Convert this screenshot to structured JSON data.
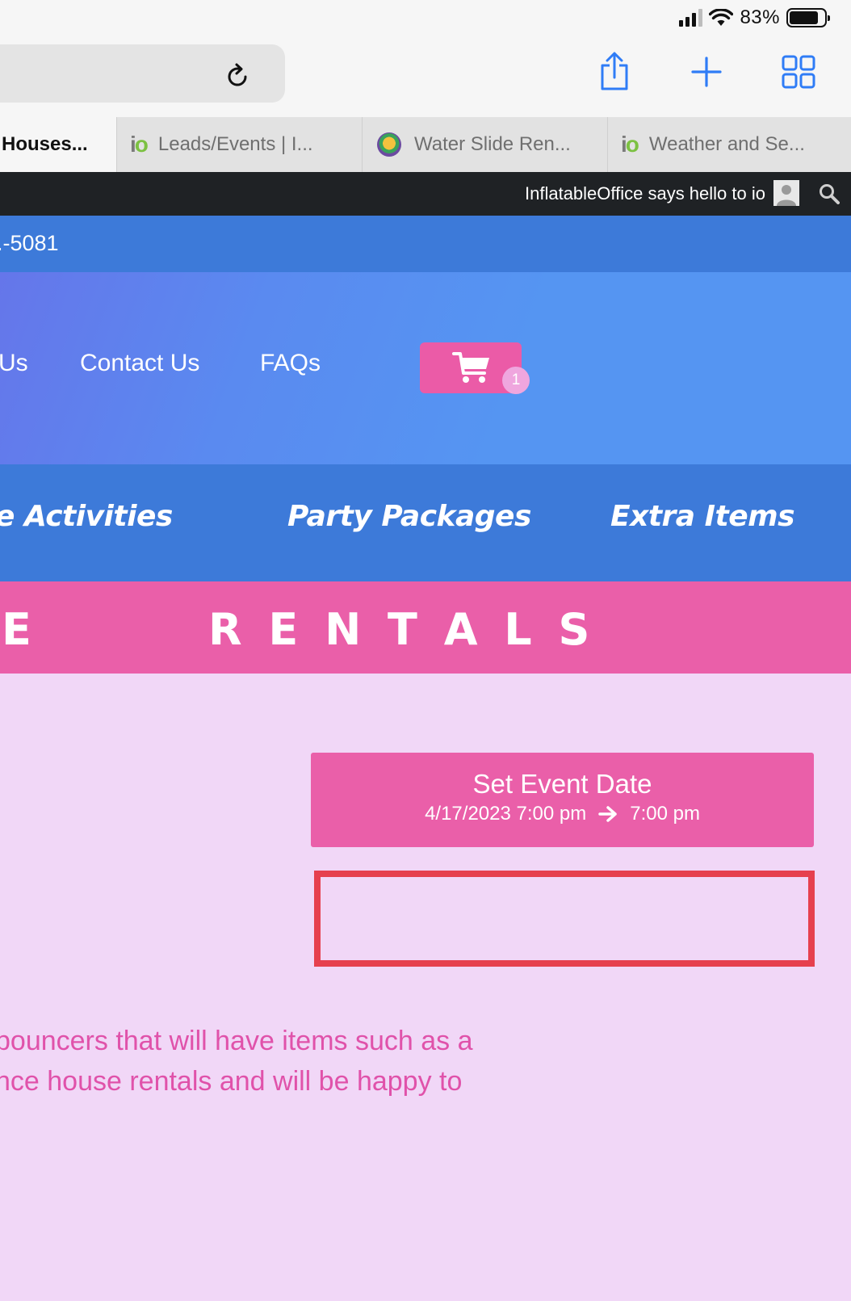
{
  "status_bar": {
    "battery_percent": "83%",
    "battery_level": 0.83
  },
  "tabs": [
    {
      "label": "Houses..."
    },
    {
      "label": "Leads/Events | I...",
      "icon": "io-logo-icon"
    },
    {
      "label": "Water Slide Ren...",
      "icon": "site-favicon-icon"
    },
    {
      "label": "Weather and Se...",
      "icon": "io-logo-icon"
    }
  ],
  "io_logo": {
    "i": "i",
    "o": "o"
  },
  "admin_bar": {
    "greeting": "InflatableOffice says hello to io"
  },
  "header": {
    "phone": ".-5081",
    "nav": [
      "Us",
      "Contact Us",
      "FAQs"
    ],
    "cart_count": "1"
  },
  "categories": [
    "e Activities",
    "Party Packages",
    "Extra Items"
  ],
  "banner": {
    "left": "E",
    "right": "R E N T A L S"
  },
  "event": {
    "title": "Set Event Date",
    "start": "4/17/2023 7:00 pm",
    "end": "7:00 pm"
  },
  "body_text": [
    "bouncers that will have items such as a",
    "nce house rentals and will be happy to"
  ],
  "colors": {
    "pink": "#ea5fa9",
    "blue": "#3d7ad9",
    "lavender": "#f1d7f7",
    "red_outline": "#e6404e"
  }
}
